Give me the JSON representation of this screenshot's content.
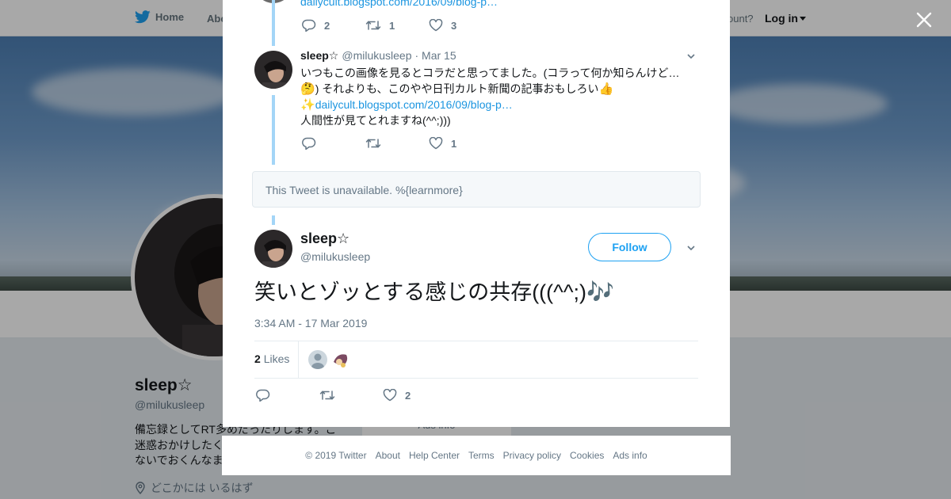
{
  "nav": {
    "home_label": "Home",
    "about_label": "Abo",
    "account_text": "ccount?",
    "login_label": "Log in"
  },
  "profile": {
    "name": "sleep☆",
    "handle": "@milukusleep",
    "bio_lines": [
      "備忘録としてRT多めだったりします。ご",
      "迷惑おかけしたく",
      "ないでおくんなま"
    ],
    "location": "どこかには いるはず",
    "card_text": "Ads info"
  },
  "modal": {
    "prev_tweet": {
      "link_text": "dailycult.blogspot.com/2016/09/blog-p…",
      "replies": "2",
      "retweets": "1",
      "likes": "3"
    },
    "reply_tweet": {
      "name": "sleep☆",
      "handle": "@milukusleep",
      "date": "· Mar 15",
      "line1": "いつもこの画像を見るとコラだと思ってました。(コラって何か知らんけど…",
      "line2_emoji": "🤔",
      "line2_text": ") それよりも、このやや日刊カルト新聞の記事おもしろい",
      "line2_emoji_end": "👍",
      "line3_emoji": "✨",
      "line3_link": "dailycult.blogspot.com/2016/09/blog-p…",
      "line4": "人間性が見てとれますね(^^;)))",
      "replies": "",
      "retweets": "",
      "likes": "1"
    },
    "unavailable_text": "This Tweet is unavailable. %{learnmore}",
    "main_tweet": {
      "name": "sleep☆",
      "handle": "@milukusleep",
      "follow_label": "Follow",
      "text": "笑いとゾッとする感じの共存(((^^;)",
      "text_emoji": "🎶",
      "timestamp": "3:34 AM - 17 Mar 2019",
      "likes_count": "2",
      "likes_label": "Likes",
      "replies": "",
      "retweets": "",
      "likes": "2"
    }
  },
  "footer": {
    "items": [
      "© 2019 Twitter",
      "About",
      "Help Center",
      "Terms",
      "Privacy policy",
      "Cookies",
      "Ads info"
    ]
  },
  "colors": {
    "accent": "#1da1f2",
    "link": "#1b95e0",
    "thread_line": "#a3d5f7",
    "muted_text": "#657786"
  }
}
